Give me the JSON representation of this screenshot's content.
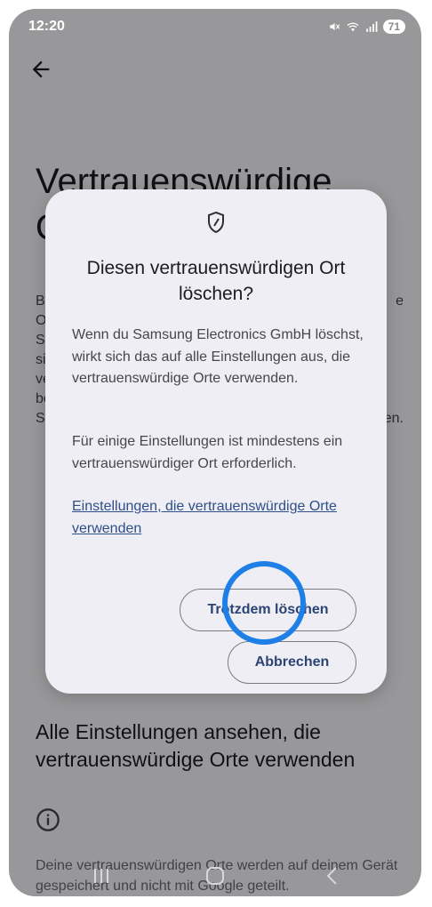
{
  "status_bar": {
    "time": "12:20",
    "battery": "71",
    "icons": [
      "mute-icon",
      "wifi-icon",
      "signal-icon"
    ]
  },
  "background": {
    "title_lines": [
      "Vertrauenswürdige",
      "O"
    ],
    "body_left": [
      "B",
      "O",
      "S",
      "si",
      "ve",
      "be",
      "S"
    ],
    "body_right_1": "e",
    "body_right_2": "en.",
    "section_title": "Alle Einstellungen ansehen, die vertrauenswürdige Orte verwenden",
    "footer": "Deine vertrauenswürdigen Orte werden auf deinem Gerät gespeichert und nicht mit Google geteilt."
  },
  "dialog": {
    "icon": "shield-icon",
    "title": "Diesen vertrauenswürdigen Ort löschen?",
    "paragraph_1": "Wenn du Samsung Electronics GmbH löschst, wirkt sich das auf alle Einstellungen aus, die vertrauenswürdige Orte verwenden.",
    "paragraph_2": "Für einige Einstellungen ist mindestens ein vertrauenswürdiger Ort erforderlich.",
    "link": "Einstellungen, die vertrauenswürdige Orte verwenden",
    "delete_button": "Trotzdem löschen",
    "cancel_button": "Abbrechen"
  },
  "colors": {
    "accent": "#2b4474",
    "highlight_ring": "#1e7fe6",
    "dialog_bg": "#eeeef4"
  }
}
